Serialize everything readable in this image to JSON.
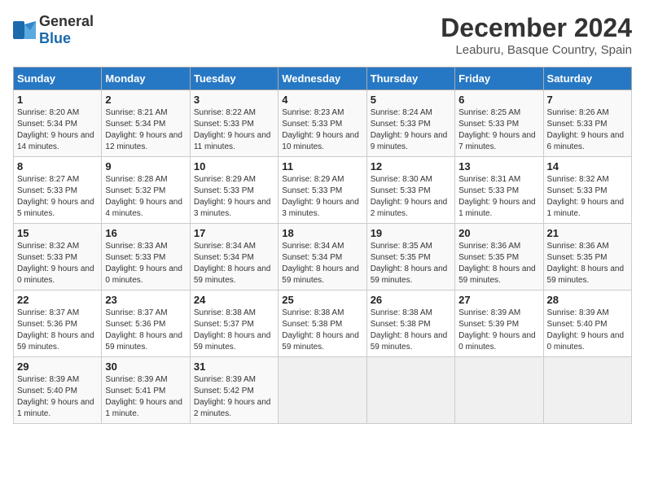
{
  "logo": {
    "general": "General",
    "blue": "Blue"
  },
  "title": "December 2024",
  "location": "Leaburu, Basque Country, Spain",
  "days_of_week": [
    "Sunday",
    "Monday",
    "Tuesday",
    "Wednesday",
    "Thursday",
    "Friday",
    "Saturday"
  ],
  "weeks": [
    [
      {
        "day": "1",
        "sunrise": "Sunrise: 8:20 AM",
        "sunset": "Sunset: 5:34 PM",
        "daylight": "Daylight: 9 hours and 14 minutes."
      },
      {
        "day": "2",
        "sunrise": "Sunrise: 8:21 AM",
        "sunset": "Sunset: 5:34 PM",
        "daylight": "Daylight: 9 hours and 12 minutes."
      },
      {
        "day": "3",
        "sunrise": "Sunrise: 8:22 AM",
        "sunset": "Sunset: 5:33 PM",
        "daylight": "Daylight: 9 hours and 11 minutes."
      },
      {
        "day": "4",
        "sunrise": "Sunrise: 8:23 AM",
        "sunset": "Sunset: 5:33 PM",
        "daylight": "Daylight: 9 hours and 10 minutes."
      },
      {
        "day": "5",
        "sunrise": "Sunrise: 8:24 AM",
        "sunset": "Sunset: 5:33 PM",
        "daylight": "Daylight: 9 hours and 9 minutes."
      },
      {
        "day": "6",
        "sunrise": "Sunrise: 8:25 AM",
        "sunset": "Sunset: 5:33 PM",
        "daylight": "Daylight: 9 hours and 7 minutes."
      },
      {
        "day": "7",
        "sunrise": "Sunrise: 8:26 AM",
        "sunset": "Sunset: 5:33 PM",
        "daylight": "Daylight: 9 hours and 6 minutes."
      }
    ],
    [
      {
        "day": "8",
        "sunrise": "Sunrise: 8:27 AM",
        "sunset": "Sunset: 5:33 PM",
        "daylight": "Daylight: 9 hours and 5 minutes."
      },
      {
        "day": "9",
        "sunrise": "Sunrise: 8:28 AM",
        "sunset": "Sunset: 5:32 PM",
        "daylight": "Daylight: 9 hours and 4 minutes."
      },
      {
        "day": "10",
        "sunrise": "Sunrise: 8:29 AM",
        "sunset": "Sunset: 5:33 PM",
        "daylight": "Daylight: 9 hours and 3 minutes."
      },
      {
        "day": "11",
        "sunrise": "Sunrise: 8:29 AM",
        "sunset": "Sunset: 5:33 PM",
        "daylight": "Daylight: 9 hours and 3 minutes."
      },
      {
        "day": "12",
        "sunrise": "Sunrise: 8:30 AM",
        "sunset": "Sunset: 5:33 PM",
        "daylight": "Daylight: 9 hours and 2 minutes."
      },
      {
        "day": "13",
        "sunrise": "Sunrise: 8:31 AM",
        "sunset": "Sunset: 5:33 PM",
        "daylight": "Daylight: 9 hours and 1 minute."
      },
      {
        "day": "14",
        "sunrise": "Sunrise: 8:32 AM",
        "sunset": "Sunset: 5:33 PM",
        "daylight": "Daylight: 9 hours and 1 minute."
      }
    ],
    [
      {
        "day": "15",
        "sunrise": "Sunrise: 8:32 AM",
        "sunset": "Sunset: 5:33 PM",
        "daylight": "Daylight: 9 hours and 0 minutes."
      },
      {
        "day": "16",
        "sunrise": "Sunrise: 8:33 AM",
        "sunset": "Sunset: 5:33 PM",
        "daylight": "Daylight: 9 hours and 0 minutes."
      },
      {
        "day": "17",
        "sunrise": "Sunrise: 8:34 AM",
        "sunset": "Sunset: 5:34 PM",
        "daylight": "Daylight: 8 hours and 59 minutes."
      },
      {
        "day": "18",
        "sunrise": "Sunrise: 8:34 AM",
        "sunset": "Sunset: 5:34 PM",
        "daylight": "Daylight: 8 hours and 59 minutes."
      },
      {
        "day": "19",
        "sunrise": "Sunrise: 8:35 AM",
        "sunset": "Sunset: 5:35 PM",
        "daylight": "Daylight: 8 hours and 59 minutes."
      },
      {
        "day": "20",
        "sunrise": "Sunrise: 8:36 AM",
        "sunset": "Sunset: 5:35 PM",
        "daylight": "Daylight: 8 hours and 59 minutes."
      },
      {
        "day": "21",
        "sunrise": "Sunrise: 8:36 AM",
        "sunset": "Sunset: 5:35 PM",
        "daylight": "Daylight: 8 hours and 59 minutes."
      }
    ],
    [
      {
        "day": "22",
        "sunrise": "Sunrise: 8:37 AM",
        "sunset": "Sunset: 5:36 PM",
        "daylight": "Daylight: 8 hours and 59 minutes."
      },
      {
        "day": "23",
        "sunrise": "Sunrise: 8:37 AM",
        "sunset": "Sunset: 5:36 PM",
        "daylight": "Daylight: 8 hours and 59 minutes."
      },
      {
        "day": "24",
        "sunrise": "Sunrise: 8:38 AM",
        "sunset": "Sunset: 5:37 PM",
        "daylight": "Daylight: 8 hours and 59 minutes."
      },
      {
        "day": "25",
        "sunrise": "Sunrise: 8:38 AM",
        "sunset": "Sunset: 5:38 PM",
        "daylight": "Daylight: 8 hours and 59 minutes."
      },
      {
        "day": "26",
        "sunrise": "Sunrise: 8:38 AM",
        "sunset": "Sunset: 5:38 PM",
        "daylight": "Daylight: 8 hours and 59 minutes."
      },
      {
        "day": "27",
        "sunrise": "Sunrise: 8:39 AM",
        "sunset": "Sunset: 5:39 PM",
        "daylight": "Daylight: 9 hours and 0 minutes."
      },
      {
        "day": "28",
        "sunrise": "Sunrise: 8:39 AM",
        "sunset": "Sunset: 5:40 PM",
        "daylight": "Daylight: 9 hours and 0 minutes."
      }
    ],
    [
      {
        "day": "29",
        "sunrise": "Sunrise: 8:39 AM",
        "sunset": "Sunset: 5:40 PM",
        "daylight": "Daylight: 9 hours and 1 minute."
      },
      {
        "day": "30",
        "sunrise": "Sunrise: 8:39 AM",
        "sunset": "Sunset: 5:41 PM",
        "daylight": "Daylight: 9 hours and 1 minute."
      },
      {
        "day": "31",
        "sunrise": "Sunrise: 8:39 AM",
        "sunset": "Sunset: 5:42 PM",
        "daylight": "Daylight: 9 hours and 2 minutes."
      },
      null,
      null,
      null,
      null
    ]
  ]
}
